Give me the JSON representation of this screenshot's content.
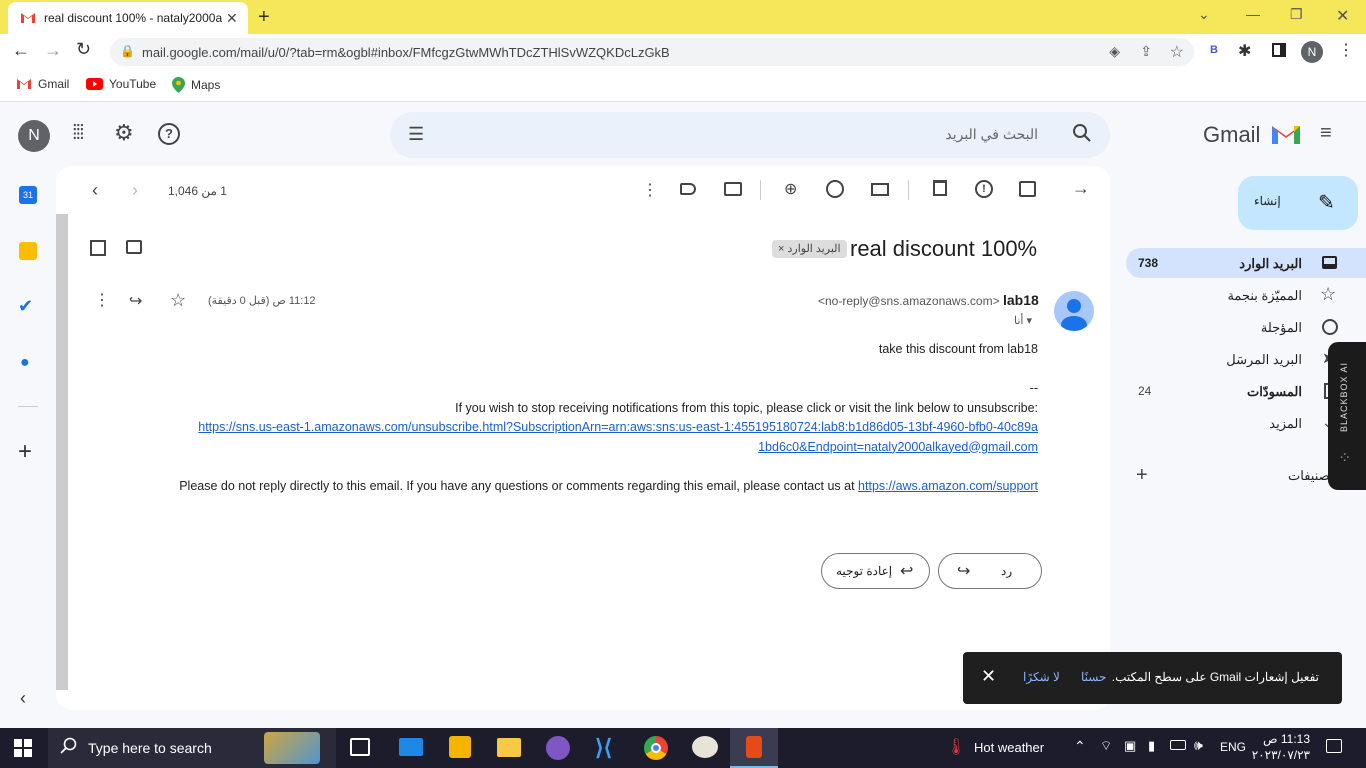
{
  "browser": {
    "tab_title": "real discount 100% - nataly2000a",
    "url": "mail.google.com/mail/u/0/?tab=rm&ogbl#inbox/FMfcgzGtwMWhTDcZTHlSvWZQKDcLzGkB",
    "profile_initial": "N",
    "ext_letter": "B",
    "bookmarks": [
      "Gmail",
      "YouTube",
      "Maps"
    ]
  },
  "gmail": {
    "logo_text": "Gmail",
    "search_placeholder": "البحث في البريد",
    "account_initial": "N",
    "compose_label": "إنشاء",
    "nav": [
      {
        "label": "البريد الوارد",
        "count": "738"
      },
      {
        "label": "المميّزة بنجمة",
        "count": ""
      },
      {
        "label": "المؤجلة",
        "count": ""
      },
      {
        "label": "البريد المرسَل",
        "count": ""
      },
      {
        "label": "المسودّات",
        "count": "24"
      },
      {
        "label": "المزيد",
        "count": ""
      }
    ],
    "labels_header": "تصنيفات",
    "pagination": "1 من 1,046"
  },
  "email": {
    "subject": "real discount 100%",
    "label_chip": "البريد الوارد",
    "sender_name": "lab18",
    "sender_email": "<no-reply@sns.amazonaws.com>",
    "to": "أنا",
    "time": "11:12 ص (قبل 0 دقيقة)",
    "body_line1": "take this discount from lab18",
    "body_sep": "--",
    "body_unsub": "If you wish to stop receiving notifications from this topic, please click or visit the link below to unsubscribe:",
    "unsub_link_1": "https://sns.us-east-1.amazonaws.com/unsubscribe.html?SubscriptionArn=arn:aws:sns:us-east-1:455195180724:lab8:b1d86d05-13bf-4960-bfb0-40c89a",
    "unsub_link_2": "1bd6c0&Endpoint=nataly2000alkayed@gmail.com",
    "body_footer": "Please do not reply directly to this email. If you have any questions or comments regarding this email, please contact us at",
    "support_link": "https://aws.amazon.com/support",
    "reply_label": "رد",
    "forward_label": "إعادة توجيه"
  },
  "toast": {
    "message": "تفعيل إشعارات Gmail على سطح المكتب.",
    "ok": "حسنًا",
    "no": "لا شكرًا"
  },
  "blackbox": "BLACKBOX AI",
  "taskbar": {
    "search": "Type here to search",
    "weather": "Hot weather",
    "lang": "ENG",
    "time": "11:13 ص",
    "date": "٢٠٢٣/٠٧/٢٣"
  }
}
